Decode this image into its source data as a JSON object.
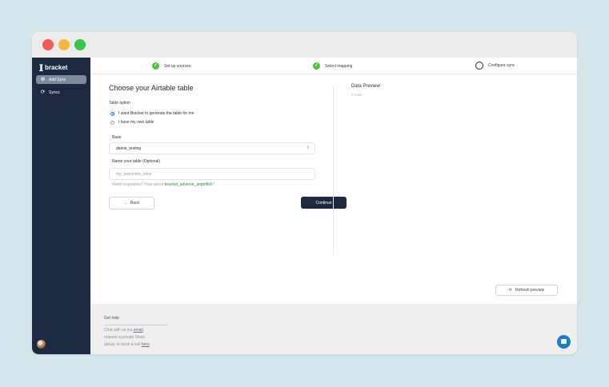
{
  "window": {
    "controls": [
      "close",
      "minimize",
      "maximize"
    ]
  },
  "sidebar": {
    "logo_mark": "][",
    "logo_text": "bracket",
    "items": [
      {
        "label": "Add Sync",
        "icon": "plus-circle-icon",
        "glyph": "⊕",
        "active": true
      },
      {
        "label": "Syncs",
        "icon": "refresh-icon",
        "glyph": "⟳",
        "active": false
      }
    ]
  },
  "stepper": {
    "steps": [
      {
        "label": "Set up sources",
        "status": "complete",
        "glyph": "✓"
      },
      {
        "label": "Select mapping",
        "status": "complete",
        "glyph": "✓"
      },
      {
        "label": "Configure sync",
        "status": "current",
        "glyph": ""
      }
    ]
  },
  "form": {
    "title": "Choose your Airtable table",
    "table_option_label": "Table option",
    "options": [
      {
        "label": "I want Bracket to generate the table for me",
        "selected": true
      },
      {
        "label": "I have my own table",
        "selected": false
      }
    ],
    "base_label": "Base",
    "base_value": "delete_testing",
    "base_chevron": "⇕",
    "name_label": "Name your table (Optional)",
    "name_placeholder": "my_awesome_table",
    "hint_prefix": "Need inspiration? How about ",
    "hint_suggestion": "bracket_adverse_angelfish",
    "hint_suffix": "?",
    "back_label": "Back",
    "back_glyph": "←",
    "continue_label": "Continue"
  },
  "preview": {
    "title": "Data Preview",
    "rows": "0 rows",
    "refresh_label": "Refresh preview",
    "refresh_glyph": "⟳"
  },
  "footer": {
    "help_title": "Get help",
    "line1_prefix": "Chat with us via ",
    "line1_link": "email",
    "line1_suffix": ",",
    "line2": "request a private Slack",
    "line3_prefix": "group, or book a call ",
    "line3_link": "here",
    "line3_suffix": "."
  },
  "colors": {
    "background": "#d3e6ec",
    "sidebar": "#1c2940",
    "accent_green": "#4cc23b",
    "primary_button": "#1c2940",
    "chat_button": "#1f7ec1"
  }
}
